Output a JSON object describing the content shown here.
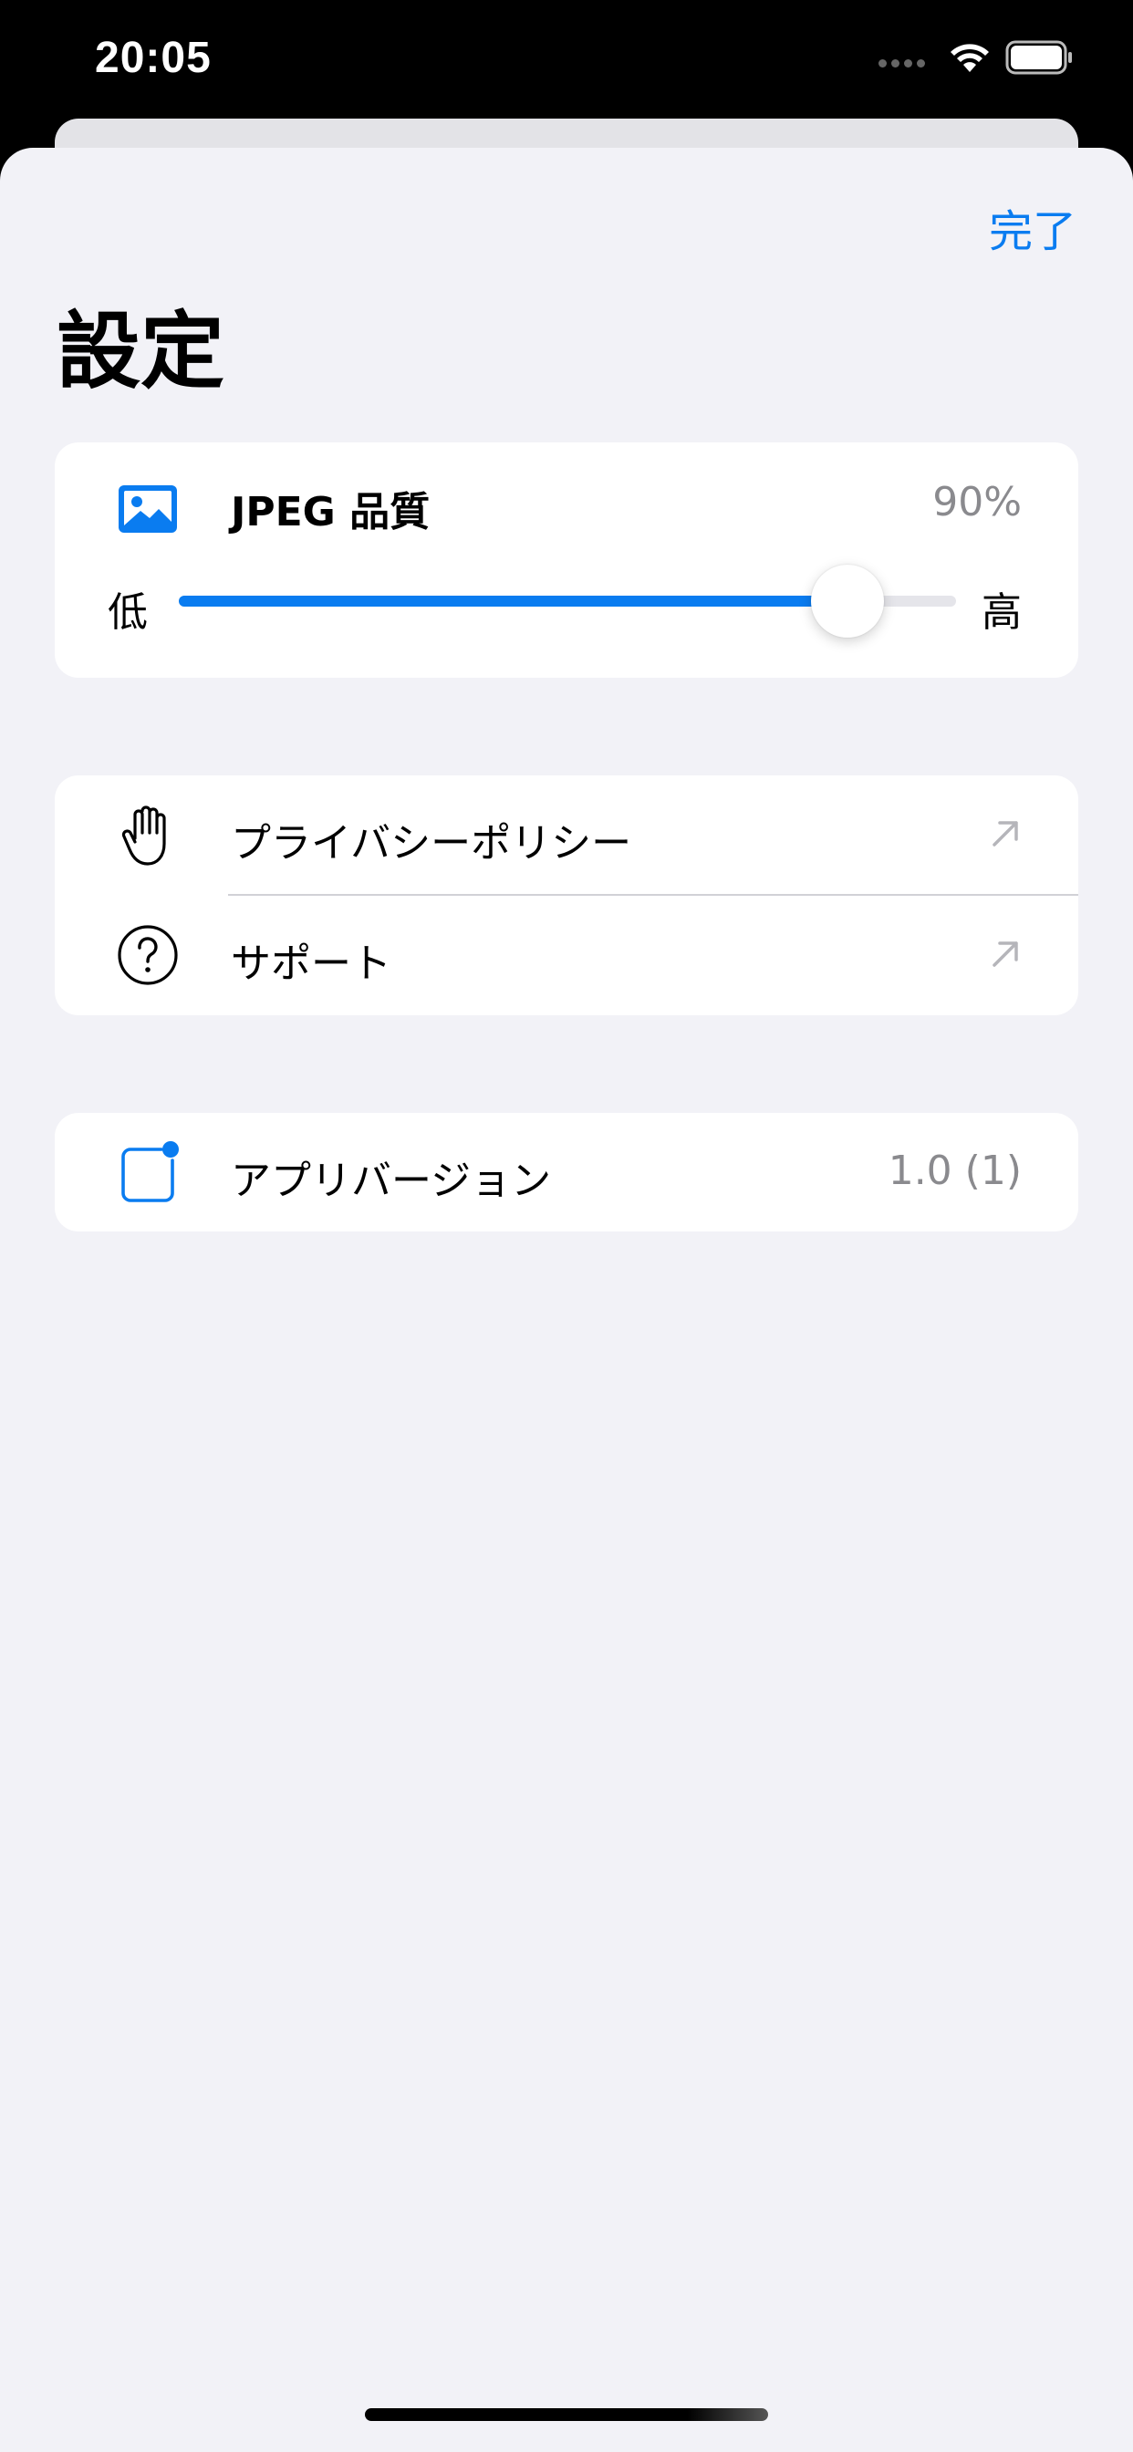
{
  "status_bar": {
    "time": "20:05"
  },
  "nav": {
    "done_label": "完了",
    "title": "設定"
  },
  "jpeg_quality": {
    "icon": "photo-icon",
    "label": "JPEG 品質",
    "value_text": "90%",
    "slider_min_label": "低",
    "slider_max_label": "高",
    "slider_fraction": 0.86
  },
  "links": [
    {
      "icon": "hand-raised-icon",
      "label": "プライバシーポリシー",
      "accessory": "external-link-arrow-icon"
    },
    {
      "icon": "question-circle-icon",
      "label": "サポート",
      "accessory": "external-link-arrow-icon"
    }
  ],
  "version": {
    "icon": "app-badge-icon",
    "label": "アプリバージョン",
    "value": "1.0 (1)"
  },
  "colors": {
    "accent": "#0a7cf0",
    "sheet_background": "#f2f2f7",
    "card_background": "#ffffff",
    "secondary_text": "#8a8a8e"
  }
}
